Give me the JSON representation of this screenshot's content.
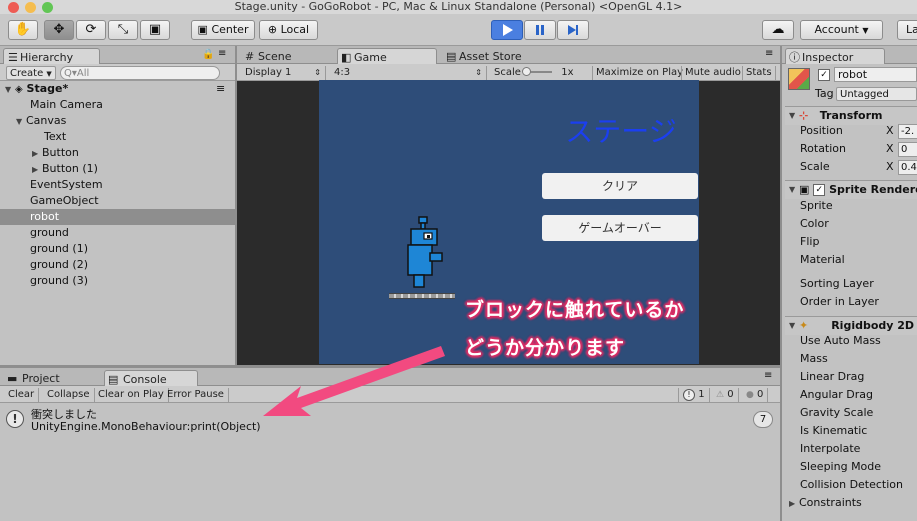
{
  "window": {
    "title": "Stage.unity - GoGoRobot - PC, Mac & Linux Standalone (Personal) <OpenGL 4.1>"
  },
  "toolbar": {
    "pivot_center": "Center",
    "pivot_local": "Local",
    "account": "Account",
    "layers": "La"
  },
  "hierarchy": {
    "tab": "Hierarchy",
    "create": "Create",
    "search_placeholder": "Q▾All",
    "scene": "Stage*",
    "items": [
      {
        "label": "Main Camera"
      },
      {
        "label": "Canvas"
      },
      {
        "label": "Text"
      },
      {
        "label": "Button"
      },
      {
        "label": "Button (1)"
      },
      {
        "label": "EventSystem"
      },
      {
        "label": "GameObject"
      },
      {
        "label": "robot"
      },
      {
        "label": "ground"
      },
      {
        "label": "ground (1)"
      },
      {
        "label": "ground (2)"
      },
      {
        "label": "ground (3)"
      }
    ]
  },
  "center_tabs": {
    "scene": "Scene",
    "game": "Game",
    "asset_store": "Asset Store"
  },
  "game_bar": {
    "display": "Display 1",
    "aspect": "4:3",
    "scale_label": "Scale",
    "scale_value": "1x",
    "maximize": "Maximize on Play",
    "mute": "Mute audio",
    "stats": "Stats"
  },
  "game": {
    "stage_title": "ステージ",
    "clear_button": "クリア",
    "gameover_button": "ゲームオーバー"
  },
  "annotation": {
    "line1": "ブロックに触れているか",
    "line2": "どうか分かります",
    "color": "#e8336b"
  },
  "bottom_tabs": {
    "project": "Project",
    "console": "Console"
  },
  "console": {
    "buttons": [
      "Clear",
      "Collapse",
      "Clear on Play",
      "Error Pause"
    ],
    "count_log": "1",
    "count_warn": "0",
    "count_error": "0",
    "message_line1": "衝突しました",
    "message_line2": "UnityEngine.MonoBehaviour:print(Object)",
    "collapse_count": "7"
  },
  "inspector": {
    "tab": "Inspector",
    "object_name": "robot",
    "tag_label": "Tag",
    "tag_value": "Untagged",
    "transform": {
      "title": "Transform",
      "position_label": "Position",
      "rotation_label": "Rotation",
      "scale_label": "Scale",
      "x_label": "X",
      "position_x": "-2.",
      "rotation_x": "0",
      "scale_x": "0.4"
    },
    "sprite_renderer": {
      "title": "Sprite Renderer",
      "fields": [
        "Sprite",
        "Color",
        "Flip",
        "Material",
        "Sorting Layer",
        "Order in Layer"
      ]
    },
    "rigidbody": {
      "title": "Rigidbody 2D",
      "fields": [
        "Use Auto Mass",
        "Mass",
        "Linear Drag",
        "Angular Drag",
        "Gravity Scale",
        "Is Kinematic",
        "Interpolate",
        "Sleeping Mode",
        "Collision Detection",
        "Constraints"
      ]
    }
  },
  "colors": {
    "game_bg": "#2e4d79",
    "stage_title": "#1b3ff0",
    "play_button": "#4a7fe0",
    "robot": "#1e86d6"
  }
}
